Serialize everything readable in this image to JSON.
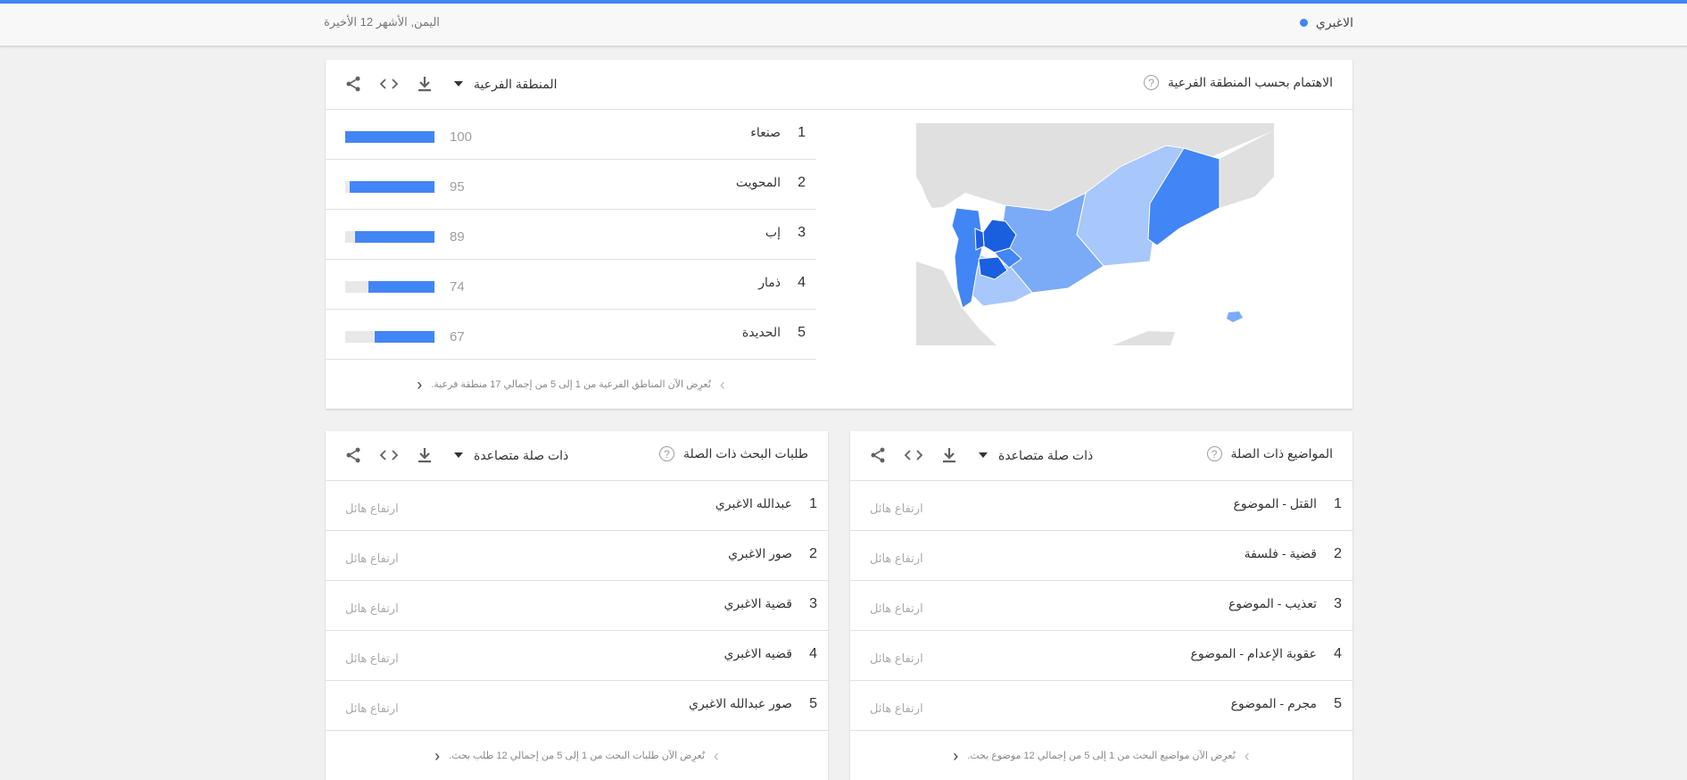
{
  "header": {
    "search_term": "الاغبري",
    "term_color": "#4285f4",
    "scope": "اليمن, الأشهر 12 الأخيرة"
  },
  "region_card": {
    "title": "الاهتمام بحسب المنطقة الفرعية",
    "dropdown_label": "المنطقة الفرعية",
    "icons": [
      "help-icon",
      "caret-down-icon",
      "download-icon",
      "embed-icon",
      "share-icon"
    ],
    "rows": [
      {
        "rank": "1",
        "label": "صنعاء",
        "value": 100
      },
      {
        "rank": "2",
        "label": "المحويت",
        "value": 95
      },
      {
        "rank": "3",
        "label": "إب",
        "value": 89
      },
      {
        "rank": "4",
        "label": "ذمار",
        "value": 74
      },
      {
        "rank": "5",
        "label": "الحديدة",
        "value": 67
      }
    ],
    "footer": "نُعرِض الآن المناطق الفرعية من 1 إلى 5 من إجمالي 17 منطقة فرعية.",
    "map_colors": {
      "sea": "#ffffff",
      "land": "#e0e0e0",
      "light": "#a8c7fa",
      "medium": "#7baaf7",
      "dark": "#1a5fe0",
      "accent": "#4285f4"
    }
  },
  "topics_card": {
    "title": "المواضيع ذات الصلة",
    "dropdown_label": "ذات صلة متصاعدة",
    "rows": [
      {
        "rank": "1",
        "label": "القتل - الموضوع",
        "value": "ارتفاع هائل"
      },
      {
        "rank": "2",
        "label": "قضية - فلسفة",
        "value": "ارتفاع هائل"
      },
      {
        "rank": "3",
        "label": "تعذيب - الموضوع",
        "value": "ارتفاع هائل"
      },
      {
        "rank": "4",
        "label": "عقوبة الإعدام - الموضوع",
        "value": "ارتفاع هائل"
      },
      {
        "rank": "5",
        "label": "مجرم - الموضوع",
        "value": "ارتفاع هائل"
      }
    ],
    "footer": "نُعرِض الآن مواضيع البحث من 1 إلى 5 من إجمالي 12 موضوع بحث."
  },
  "queries_card": {
    "title": "طلبات البحث ذات الصلة",
    "dropdown_label": "ذات صلة متصاعدة",
    "rows": [
      {
        "rank": "1",
        "label": "عبدالله الاغبري",
        "value": "ارتفاع هائل"
      },
      {
        "rank": "2",
        "label": "صور الاغبري",
        "value": "ارتفاع هائل"
      },
      {
        "rank": "3",
        "label": "قضية الاغبري",
        "value": "ارتفاع هائل"
      },
      {
        "rank": "4",
        "label": "قضيه الاغبري",
        "value": "ارتفاع هائل"
      },
      {
        "rank": "5",
        "label": "صور عبدالله الاغبري",
        "value": "ارتفاع هائل"
      }
    ],
    "footer": "نُعرِض الآن طلبات البحث من 1 إلى 5 من إجمالي 12 طلب بحث."
  }
}
